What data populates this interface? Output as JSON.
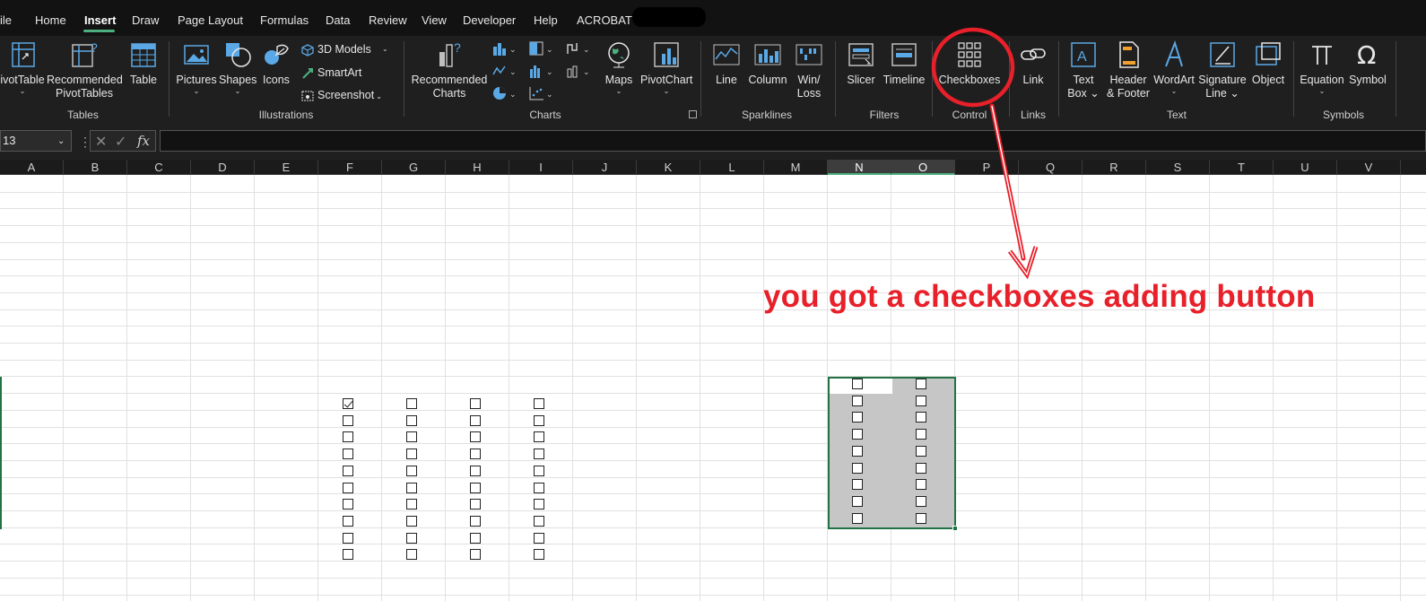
{
  "menu": {
    "tabs": [
      {
        "label": "ile",
        "active": false
      },
      {
        "label": "Home",
        "active": false
      },
      {
        "label": "Insert",
        "active": true
      },
      {
        "label": "Draw",
        "active": false
      },
      {
        "label": "Page Layout",
        "active": false
      },
      {
        "label": "Formulas",
        "active": false
      },
      {
        "label": "Data",
        "active": false
      },
      {
        "label": "Review",
        "active": false
      },
      {
        "label": "View",
        "active": false
      },
      {
        "label": "Developer",
        "active": false
      },
      {
        "label": "Help",
        "active": false
      },
      {
        "label": "ACROBAT",
        "active": false
      }
    ]
  },
  "ribbon": {
    "tables": {
      "pivottable": "ivotTable",
      "recommended_pivottables_1": "Recommended",
      "recommended_pivottables_2": "PivotTables",
      "table": "Table",
      "group_label": "Tables"
    },
    "illustrations": {
      "pictures": "Pictures",
      "shapes": "Shapes",
      "icons": "Icons",
      "models_3d": "3D Models",
      "smartart": "SmartArt",
      "screenshot": "Screenshot",
      "group_label": "Illustrations"
    },
    "charts": {
      "recommended_charts_1": "Recommended",
      "recommended_charts_2": "Charts",
      "maps": "Maps",
      "pivotchart": "PivotChart",
      "group_label": "Charts"
    },
    "sparklines": {
      "line": "Line",
      "column": "Column",
      "winloss_1": "Win/",
      "winloss_2": "Loss",
      "group_label": "Sparklines"
    },
    "filters": {
      "slicer": "Slicer",
      "timeline": "Timeline",
      "group_label": "Filters"
    },
    "control": {
      "checkboxes": "Checkboxes",
      "group_label": "Control"
    },
    "links": {
      "link": "Link",
      "group_label": "Links"
    },
    "text": {
      "textbox_1": "Text",
      "textbox_2": "Box",
      "header_footer_1": "Header",
      "header_footer_2": "& Footer",
      "wordart": "WordArt",
      "signature_1": "Signature",
      "signature_2": "Line",
      "object": "Object",
      "group_label": "Text"
    },
    "symbols": {
      "equation": "Equation",
      "symbol": "Symbol",
      "group_label": "Symbols"
    }
  },
  "formula_bar": {
    "name_box": "13",
    "fx": "fx",
    "formula": ""
  },
  "columns": [
    "A",
    "B",
    "C",
    "D",
    "E",
    "F",
    "G",
    "H",
    "I",
    "J",
    "K",
    "L",
    "M",
    "N",
    "O",
    "P",
    "Q",
    "R",
    "S",
    "T",
    "U",
    "V"
  ],
  "selected_columns": [
    "N",
    "O"
  ],
  "checkbox_grid_left": {
    "columns": [
      "F",
      "G",
      "H",
      "I"
    ],
    "rows": 10,
    "checked": [
      [
        0,
        0
      ]
    ]
  },
  "checkbox_grid_right": {
    "columns": [
      "N",
      "O"
    ],
    "rows": 9,
    "checked": []
  },
  "annotation": {
    "text": "you got a checkboxes adding button",
    "color": "#e8202a",
    "highlights": "checkboxes-button"
  },
  "colors": {
    "menubar": "#121212",
    "ribbon": "#1f1f1f",
    "accent_green": "#217346",
    "tab_underline": "#4caf7d",
    "annotation_red": "#e8202a"
  }
}
